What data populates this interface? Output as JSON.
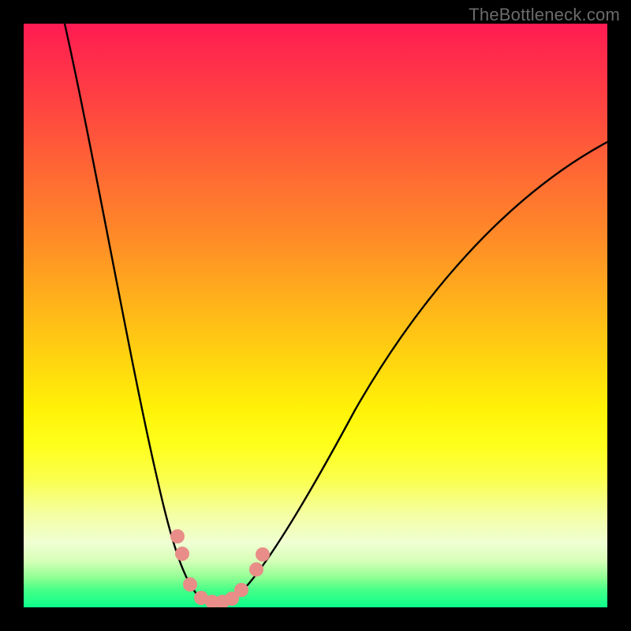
{
  "watermark": "TheBottleneck.com",
  "colors": {
    "frame_border": "#000000",
    "curve_stroke": "#000000",
    "marker_fill": "#e88d87",
    "gradient_top": "#ff1b52",
    "gradient_mid": "#fff207",
    "gradient_bottom": "#0cff8a"
  },
  "chart_data": {
    "type": "line",
    "title": "",
    "xlabel": "",
    "ylabel": "",
    "xlim": [
      0,
      100
    ],
    "ylim": [
      0,
      100
    ],
    "grid": false,
    "legend": false,
    "note": "Axes unlabeled in source image; x/y scaled 0–100 as percent of plot area. y measures height above bottom (bottom = 0, top = 100). V-shaped bottleneck curve with minimum near x ≈ 33.",
    "series": [
      {
        "name": "left_branch",
        "x": [
          7,
          10,
          13,
          16,
          19,
          22,
          25,
          27,
          29,
          30
        ],
        "y": [
          100,
          84,
          66,
          48,
          33,
          21,
          12,
          6,
          3,
          2
        ]
      },
      {
        "name": "right_branch",
        "x": [
          36,
          40,
          45,
          50,
          57,
          65,
          75,
          85,
          95,
          100
        ],
        "y": [
          2,
          7,
          16,
          25,
          34,
          45,
          57,
          68,
          77,
          80
        ]
      },
      {
        "name": "sampled_markers",
        "x": [
          26.4,
          27.2,
          28.5,
          30.4,
          32.3,
          34.0,
          35.7,
          37.3,
          39.9,
          40.9
        ],
        "y": [
          12.2,
          9.2,
          3.9,
          1.6,
          1.0,
          1.0,
          1.5,
          3.0,
          6.5,
          9.1
        ]
      }
    ],
    "background_gradient_stops": [
      {
        "pos": 0.0,
        "color": "#ff1b52"
      },
      {
        "pos": 0.15,
        "color": "#ff4740"
      },
      {
        "pos": 0.37,
        "color": "#ff8c27"
      },
      {
        "pos": 0.58,
        "color": "#ffd60f"
      },
      {
        "pos": 0.72,
        "color": "#ffff1a"
      },
      {
        "pos": 0.89,
        "color": "#efffd3"
      },
      {
        "pos": 1.0,
        "color": "#0cff8a"
      }
    ]
  }
}
